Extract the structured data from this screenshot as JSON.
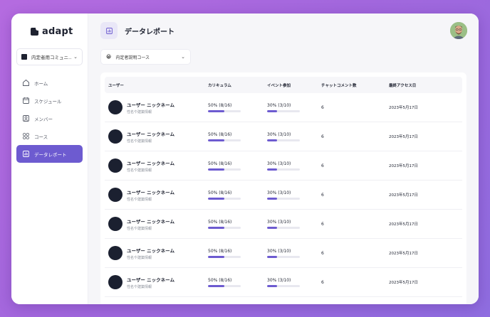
{
  "app": {
    "name": "adapt"
  },
  "sidebar": {
    "org_select": {
      "label": "内定者用コミュニ…"
    },
    "items": [
      {
        "label": "ホーム",
        "icon": "home-icon",
        "active": false
      },
      {
        "label": "スケジュール",
        "icon": "calendar-icon",
        "active": false
      },
      {
        "label": "メンバー",
        "icon": "member-icon",
        "active": false
      },
      {
        "label": "コース",
        "icon": "grid-icon",
        "active": false
      },
      {
        "label": "データレポート",
        "icon": "chart-icon",
        "active": true
      }
    ]
  },
  "header": {
    "title": "データレポート"
  },
  "course_select": {
    "emoji": "😀",
    "label": "内定者説明コース"
  },
  "table": {
    "columns": [
      "ユーザー",
      "カリキュラム",
      "イベント参加",
      "チャットコメント数",
      "最終アクセス日"
    ],
    "rows": [
      {
        "name": "ユーザー ニックネーム",
        "sub": "性名や建築情報",
        "curriculum": "50% (8/16)",
        "curriculum_progress": 0.5,
        "event": "30% (3/10)",
        "event_progress": 0.3,
        "comments": "6",
        "last_access": "2023年5月17日"
      },
      {
        "name": "ユーザー ニックネーム",
        "sub": "性名や建築情報",
        "curriculum": "50% (8/16)",
        "curriculum_progress": 0.5,
        "event": "30% (3/10)",
        "event_progress": 0.3,
        "comments": "6",
        "last_access": "2023年5月17日"
      },
      {
        "name": "ユーザー ニックネーム",
        "sub": "性名や建築情報",
        "curriculum": "50% (8/16)",
        "curriculum_progress": 0.5,
        "event": "30% (3/10)",
        "event_progress": 0.3,
        "comments": "6",
        "last_access": "2023年5月17日"
      },
      {
        "name": "ユーザー ニックネーム",
        "sub": "性名や建築情報",
        "curriculum": "50% (8/16)",
        "curriculum_progress": 0.5,
        "event": "30% (3/10)",
        "event_progress": 0.3,
        "comments": "6",
        "last_access": "2023年5月17日"
      },
      {
        "name": "ユーザー ニックネーム",
        "sub": "性名や建築情報",
        "curriculum": "50% (8/16)",
        "curriculum_progress": 0.5,
        "event": "30% (3/10)",
        "event_progress": 0.3,
        "comments": "6",
        "last_access": "2023年5月17日"
      },
      {
        "name": "ユーザー ニックネーム",
        "sub": "性名や建築情報",
        "curriculum": "50% (8/16)",
        "curriculum_progress": 0.5,
        "event": "30% (3/10)",
        "event_progress": 0.3,
        "comments": "6",
        "last_access": "2023年5月17日"
      },
      {
        "name": "ユーザー ニックネーム",
        "sub": "性名や建築情報",
        "curriculum": "50% (8/16)",
        "curriculum_progress": 0.5,
        "event": "30% (3/10)",
        "event_progress": 0.3,
        "comments": "6",
        "last_access": "2023年5月17日"
      }
    ]
  },
  "colors": {
    "accent": "#6d5bd0",
    "text": "#1e2230",
    "background_gradient_start": "#b56be0",
    "background_gradient_end": "#8f6de0"
  }
}
